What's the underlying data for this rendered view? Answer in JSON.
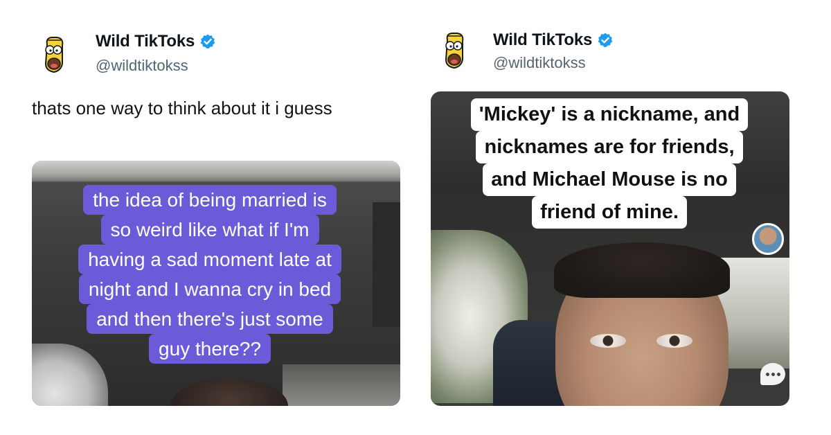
{
  "tweets": [
    {
      "account": {
        "display_name": "Wild TikToks",
        "handle": "@wildtiktokss"
      },
      "text": "thats one way to think about it i guess",
      "caption_lines": [
        "the idea of being married is",
        "so weird like what if I'm",
        "having a sad moment late at",
        "night and I wanna cry in bed",
        "and then there's just some",
        "guy there??"
      ],
      "caption_color": "#6b5bd8"
    },
    {
      "account": {
        "display_name": "Wild TikToks",
        "handle": "@wildtiktokss"
      },
      "caption_lines": [
        "'Mickey' is a nickname, and",
        "nicknames are for friends,",
        "and Michael Mouse is no",
        "friend of mine."
      ],
      "caption_color": "#ffffff"
    }
  ],
  "colors": {
    "verified_blue": "#1d9bf0",
    "handle_gray": "#536471",
    "text": "#0f1419"
  },
  "icons": [
    "avatar-homer-icon",
    "verified-badge-icon",
    "comment-bubble-icon"
  ]
}
